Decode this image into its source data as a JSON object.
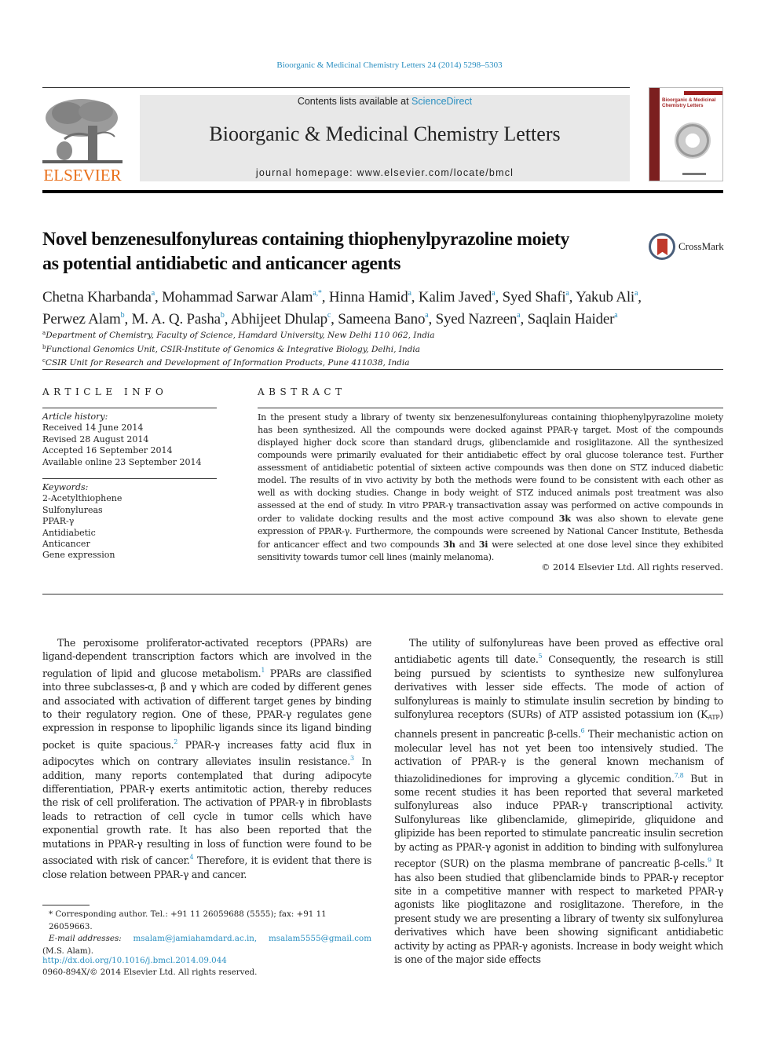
{
  "header": {
    "journal_ref": "Bioorganic & Medicinal Chemistry Letters 24 (2014) 5298–5303",
    "contents_prefix": "Contents lists available at ",
    "contents_link": "ScienceDirect",
    "journal_title": "Bioorganic & Medicinal Chemistry Letters",
    "homepage": "journal homepage: www.elsevier.com/locate/bmcl",
    "publisher_logo": "ELSEVIER",
    "cover_title": "Bioorganic & Medicinal Chemistry Letters"
  },
  "article": {
    "title_line1": "Novel benzenesulfonylureas containing thiophenylpyrazoline moiety",
    "title_line2": "as potential antidiabetic and anticancer agents",
    "crossmark_label": "CrossMark",
    "authors": [
      {
        "name": "Chetna Kharbanda",
        "aff": "a",
        "sep": ", "
      },
      {
        "name": "Mohammad Sarwar Alam",
        "aff": "a,*",
        "sep": ", "
      },
      {
        "name": "Hinna Hamid",
        "aff": "a",
        "sep": ", "
      },
      {
        "name": "Kalim Javed",
        "aff": "a",
        "sep": ", "
      },
      {
        "name": "Syed Shafi",
        "aff": "a",
        "sep": ", "
      },
      {
        "name": "Yakub Ali",
        "aff": "a",
        "sep": ","
      },
      {
        "name": "Perwez Alam",
        "aff": "b",
        "sep": ", "
      },
      {
        "name": "M. A. Q. Pasha",
        "aff": "b",
        "sep": ", "
      },
      {
        "name": "Abhijeet Dhulap",
        "aff": "c",
        "sep": ", "
      },
      {
        "name": "Sameena Bano",
        "aff": "a",
        "sep": ", "
      },
      {
        "name": "Syed Nazreen",
        "aff": "a",
        "sep": ", "
      },
      {
        "name": "Saqlain Haider",
        "aff": "a",
        "sep": ""
      }
    ],
    "affiliations": [
      {
        "key": "a",
        "text": "Department of Chemistry, Faculty of Science, Hamdard University, New Delhi 110 062, India"
      },
      {
        "key": "b",
        "text": "Functional Genomics Unit, CSIR-Institute of Genomics & Integrative Biology, Delhi, India"
      },
      {
        "key": "c",
        "text": "CSIR Unit for Research and Development of Information Products, Pune 411038, India"
      }
    ]
  },
  "article_info": {
    "heading": "ARTICLE INFO",
    "history_label": "Article history:",
    "history": [
      "Received 14 June 2014",
      "Revised 28 August 2014",
      "Accepted 16 September 2014",
      "Available online 23 September 2014"
    ],
    "keywords_label": "Keywords:",
    "keywords": [
      "2-Acetylthiophene",
      "Sulfonylureas",
      "PPAR-γ",
      "Antidiabetic",
      "Anticancer",
      "Gene expression"
    ]
  },
  "abstract": {
    "heading": "ABSTRACT",
    "part1": "In the present study a library of twenty six benzenesulfonylureas containing thiophenylpyrazoline moiety has been synthesized. All the compounds were docked against PPAR-γ target. Most of the compounds displayed higher dock score than standard drugs, glibenclamide and rosiglitazone. All the synthesized compounds were primarily evaluated for their antidiabetic effect by oral glucose tolerance test. Further assessment of antidiabetic potential of sixteen active compounds was then done on STZ induced diabetic model. The results of in vivo activity by both the methods were found to be consistent with each other as well as with docking studies. Change in body weight of STZ induced animals post treatment was also assessed at the end of study. In vitro PPAR-γ transactivation assay was performed on active compounds in order to validate docking results and the most active compound ",
    "bold1": "3k",
    "part2": " was also shown to elevate gene expression of PPAR-γ. Furthermore, the compounds were screened by National Cancer Institute, Bethesda for anticancer effect and two compounds ",
    "bold2": "3h",
    "part3": " and ",
    "bold3": "3i",
    "part4": " were selected at one dose level since they exhibited sensitivity towards tumor cell lines (mainly melanoma).",
    "copyright": "© 2014 Elsevier Ltd. All rights reserved."
  },
  "body": {
    "left": {
      "s1": "The peroxisome proliferator-activated receptors (PPARs) are ligand-dependent transcription factors which are involved in the regulation of lipid and glucose metabolism.",
      "r1": "1",
      "s2": " PPARs are classified into three subclasses-α, β and γ which are coded by different genes and associated with activation of different target genes by binding to their regulatory region. One of these, PPAR-γ regulates gene expression in response to lipophilic ligands since its ligand binding pocket is quite spacious.",
      "r2": "2",
      "s3": " PPAR-γ increases fatty acid flux in adipocytes which on contrary alleviates insulin resistance.",
      "r3": "3",
      "s4": " In addition, many reports contemplated that during adipocyte differentiation, PPAR-γ exerts antimitotic action, thereby reduces the risk of cell proliferation. The activation of PPAR-γ in fibroblasts leads to retraction of cell cycle in tumor cells which have exponential growth rate. It has also been reported that the mutations in PPAR-γ resulting in loss of function were found to be associated with risk of cancer.",
      "r4": "4",
      "s5": " Therefore, it is evident that there is close relation between PPAR-γ and cancer."
    },
    "right": {
      "s1": "The utility of sulfonylureas have been proved as effective oral antidiabetic agents till date.",
      "r5": "5",
      "s2": " Consequently, the research is still being pursued by scientists to synthesize new sulfonylurea derivatives with lesser side effects. The mode of action of sulfonylureas is mainly to stimulate insulin secretion by binding to sulfonylurea receptors (SURs) of ATP assisted potassium ion (K",
      "katp_sub": "ATP",
      "s3": ") channels present in pancreatic β-cells.",
      "r6": "6",
      "s4": " Their mechanistic action on molecular level has not yet been too intensively studied. The activation of PPAR-γ is the general known mechanism of thiazolidinediones for improving a glycemic condition.",
      "r78": "7,8",
      "s5": " But in some recent studies it has been reported that several marketed sulfonylureas also induce PPAR-γ transcriptional activity. Sulfonylureas like glibenclamide, glimepiride, gliquidone and glipizide has been reported to stimulate pancreatic insulin secretion by acting as PPAR-γ agonist in addition to binding with sulfonylurea receptor (SUR) on the plasma membrane of pancreatic β-cells.",
      "r9": "9",
      "s6": " It has also been studied that glibenclamide binds to PPAR-γ receptor site in a competitive manner with respect to marketed PPAR-γ agonists like pioglitazone and rosiglitazone. Therefore, in the present study we are presenting a library of twenty six sulfonylurea derivatives which have been showing significant antidiabetic activity by acting as PPAR-γ agonists. Increase in body weight which is one of the major side effects"
    }
  },
  "footnote": {
    "corresponding": "* Corresponding author. Tel.: +91 11 26059688 (5555); fax: +91 11 26059663.",
    "email_label": "E-mail addresses:",
    "email1": "msalam@jamiahamdard.ac.in,",
    "email2": "msalam5555@gmail.com",
    "email_owner": "(M.S. Alam).",
    "doi": "http://dx.doi.org/10.1016/j.bmcl.2014.09.044",
    "issn": "0960-894X/© 2014 Elsevier Ltd. All rights reserved."
  },
  "colors": {
    "link": "#2a8fc1",
    "elsevier_orange": "#e9711c",
    "banner_gray": "#e8e8e8",
    "cover_red": "#9b1b1b",
    "crossmark_red": "#c0392b"
  }
}
